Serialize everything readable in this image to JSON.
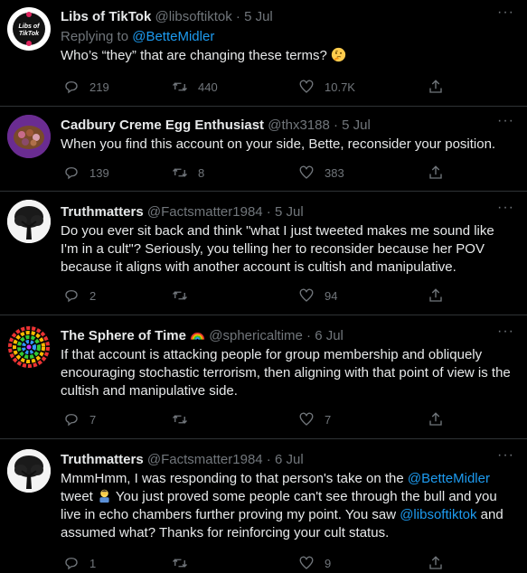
{
  "tweets": [
    {
      "name": "Libs of TikTok",
      "handle": "@libsoftiktok",
      "date": "5 Jul",
      "replying_label": "Replying to",
      "replying_to": "@BetteMidler",
      "text": "Who’s “they” that are changing these terms?",
      "emoji": "thinking-face",
      "replies": "219",
      "retweets": "440",
      "likes": "10.7K",
      "avatar_text": "Libs of TikTok"
    },
    {
      "name": "Cadbury Creme Egg Enthusiast",
      "handle": "@thx3188",
      "date": "5 Jul",
      "text": "When you find this account on your side, Bette, reconsider your position.",
      "replies": "139",
      "retweets": "8",
      "likes": "383"
    },
    {
      "name": "Truthmatters",
      "handle": "@Factsmatter1984",
      "date": "5 Jul",
      "text": "Do you ever sit back and think \"what I just tweeted makes me sound like I'm in a cult\"? Seriously, you telling her to reconsider because her POV because it aligns with another account is cultish and manipulative.",
      "replies": "2",
      "retweets": "",
      "likes": "94"
    },
    {
      "name": "The Sphere of Time",
      "name_emoji": "rainbow",
      "handle": "@sphericaltime",
      "date": "6 Jul",
      "text": "If that account is attacking people for group membership and obliquely encouraging stochastic terrorism, then aligning with that point of view is the cultish and manipulative side.",
      "replies": "7",
      "retweets": "",
      "likes": "7"
    },
    {
      "name": "Truthmatters",
      "handle": "@Factsmatter1984",
      "date": "6 Jul",
      "text_part1": "MmmHmm, I was responding to that person's take on the ",
      "mention1": "@BetteMidler",
      "text_part2": " tweet ",
      "emoji": "person-facepalming",
      "text_part3": " You just proved some people can't see through the bull and you live in echo chambers further proving my point. You saw ",
      "mention2": "@libsoftiktok",
      "text_part4": " and assumed what? Thanks for reinforcing your cult status.",
      "replies": "1",
      "retweets": "",
      "likes": "9"
    }
  ],
  "sep": " · ",
  "more": "···"
}
